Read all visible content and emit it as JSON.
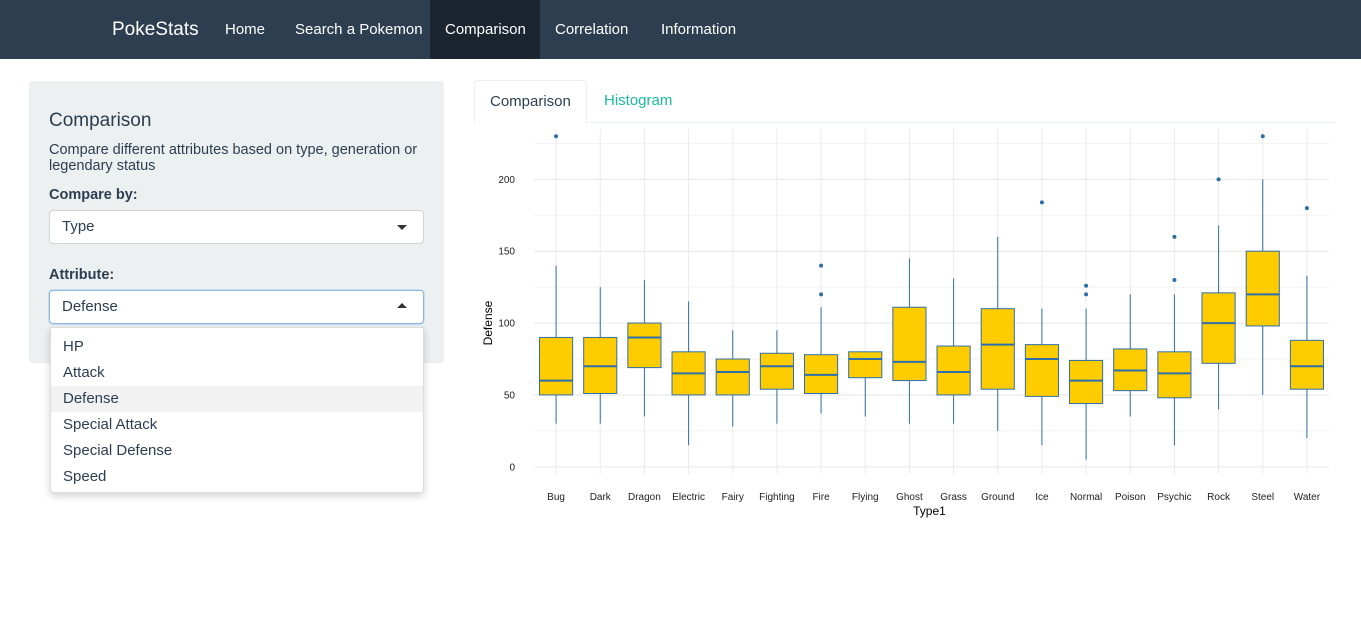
{
  "navbar": {
    "brand": "PokeStats",
    "items": [
      {
        "label": "Home",
        "active": false
      },
      {
        "label": "Search a Pokemon",
        "active": false
      },
      {
        "label": "Comparison",
        "active": true
      },
      {
        "label": "Correlation",
        "active": false
      },
      {
        "label": "Information",
        "active": false
      }
    ]
  },
  "sidebar": {
    "title": "Comparison",
    "description": "Compare different attributes based on type, generation or legendary status",
    "compare_by": {
      "label": "Compare by:",
      "value": "Type"
    },
    "attribute": {
      "label": "Attribute:",
      "value": "Defense",
      "options": [
        "HP",
        "Attack",
        "Defense",
        "Special Attack",
        "Special Defense",
        "Speed"
      ],
      "highlighted": "Defense"
    }
  },
  "tabs": [
    {
      "label": "Comparison",
      "active": true
    },
    {
      "label": "Histogram",
      "active": false
    }
  ],
  "colors": {
    "navbar": "#2c3e50",
    "navbar_active": "#1a252f",
    "accent": "#18bc9c",
    "box_fill": "#ffcc00",
    "box_line": "#2e6fa7"
  },
  "chart_data": {
    "type": "boxplot",
    "xlabel": "Type1",
    "ylabel": "Defense",
    "ylim": [
      -5,
      235
    ],
    "yticks": [
      0,
      50,
      100,
      150,
      200
    ],
    "grid": true,
    "categories": [
      "Bug",
      "Dark",
      "Dragon",
      "Electric",
      "Fairy",
      "Fighting",
      "Fire",
      "Flying",
      "Ghost",
      "Grass",
      "Ground",
      "Ice",
      "Normal",
      "Poison",
      "Psychic",
      "Rock",
      "Steel",
      "Water"
    ],
    "boxes": [
      {
        "category": "Bug",
        "min": 30,
        "q1": 50,
        "median": 60,
        "q3": 90,
        "max": 140,
        "outliers": [
          230
        ]
      },
      {
        "category": "Dark",
        "min": 30,
        "q1": 51,
        "median": 70,
        "q3": 90,
        "max": 125,
        "outliers": []
      },
      {
        "category": "Dragon",
        "min": 35,
        "q1": 69,
        "median": 90,
        "q3": 100,
        "max": 130,
        "outliers": []
      },
      {
        "category": "Electric",
        "min": 15,
        "q1": 50,
        "median": 65,
        "q3": 80,
        "max": 115,
        "outliers": []
      },
      {
        "category": "Fairy",
        "min": 28,
        "q1": 50,
        "median": 66,
        "q3": 75,
        "max": 95,
        "outliers": []
      },
      {
        "category": "Fighting",
        "min": 30,
        "q1": 54,
        "median": 70,
        "q3": 79,
        "max": 95,
        "outliers": []
      },
      {
        "category": "Fire",
        "min": 37,
        "q1": 51,
        "median": 64,
        "q3": 78,
        "max": 111,
        "outliers": [
          120,
          140
        ]
      },
      {
        "category": "Flying",
        "min": 35,
        "q1": 62,
        "median": 75,
        "q3": 80,
        "max": 80,
        "outliers": []
      },
      {
        "category": "Ghost",
        "min": 30,
        "q1": 60,
        "median": 73,
        "q3": 111,
        "max": 145,
        "outliers": []
      },
      {
        "category": "Grass",
        "min": 30,
        "q1": 50,
        "median": 66,
        "q3": 84,
        "max": 131,
        "outliers": []
      },
      {
        "category": "Ground",
        "min": 25,
        "q1": 54,
        "median": 85,
        "q3": 110,
        "max": 160,
        "outliers": []
      },
      {
        "category": "Ice",
        "min": 15,
        "q1": 49,
        "median": 75,
        "q3": 85,
        "max": 110,
        "outliers": [
          184
        ]
      },
      {
        "category": "Normal",
        "min": 5,
        "q1": 44,
        "median": 60,
        "q3": 74,
        "max": 110,
        "outliers": [
          120,
          126
        ]
      },
      {
        "category": "Poison",
        "min": 35,
        "q1": 53,
        "median": 67,
        "q3": 82,
        "max": 120,
        "outliers": []
      },
      {
        "category": "Psychic",
        "min": 15,
        "q1": 48,
        "median": 65,
        "q3": 80,
        "max": 120,
        "outliers": [
          130,
          160
        ]
      },
      {
        "category": "Rock",
        "min": 40,
        "q1": 72,
        "median": 100,
        "q3": 121,
        "max": 168,
        "outliers": [
          200
        ]
      },
      {
        "category": "Steel",
        "min": 50,
        "q1": 98,
        "median": 120,
        "q3": 150,
        "max": 200,
        "outliers": [
          230
        ]
      },
      {
        "category": "Water",
        "min": 20,
        "q1": 54,
        "median": 70,
        "q3": 88,
        "max": 133,
        "outliers": [
          180
        ]
      }
    ]
  }
}
